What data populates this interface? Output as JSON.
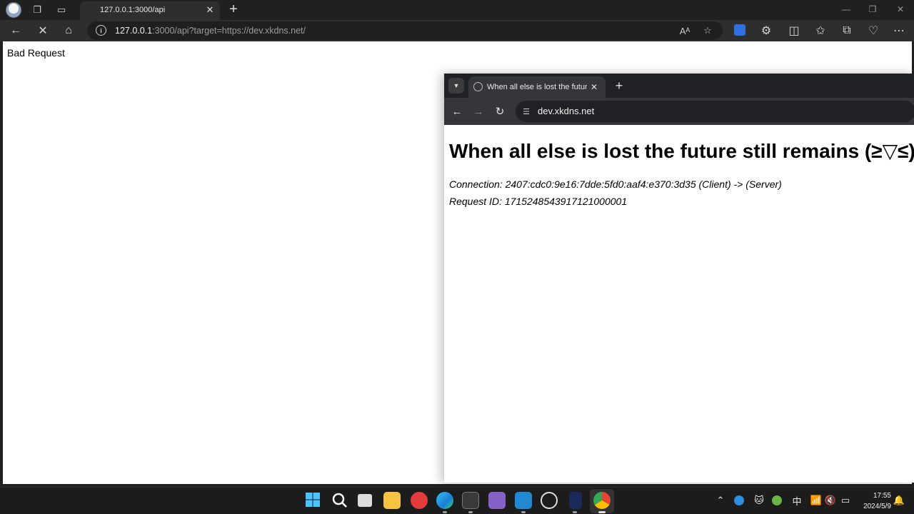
{
  "edge": {
    "tab_title": "127.0.0.1:3000/api",
    "url_host": "127.0.0.1",
    "url_rest": ":3000/api?target=https://dev.xkdns.net/",
    "page_text": "Bad Request",
    "icons": [
      "profile-icon",
      "workspaces-icon",
      "tab-actions-icon",
      "back-icon",
      "stop-loading-icon",
      "home-icon",
      "info-icon",
      "read-aloud-icon",
      "favorite-star-icon",
      "extension-icon",
      "extensions-icon",
      "split-screen-icon",
      "favorites-icon",
      "collections-icon",
      "browser-essentials-icon",
      "more-icon"
    ]
  },
  "chrome": {
    "tab_title": "When all else is lost the future still remains",
    "url": "dev.xkdns.net",
    "heading": "When all else is lost the future still remains (≥▽≤)",
    "connection": "Connection: 2407:cdc0:9e16:7dde:5fd0:aaf4:e370:3d35 (Client) -> (Server)",
    "request_id": "Request ID: 1715248543917121000001"
  },
  "taskbar": {
    "apps": [
      "start",
      "search",
      "task-view",
      "file-explorer",
      "netease-music",
      "edge",
      "terminal",
      "visual-studio",
      "vscode",
      "obs",
      "app-blue",
      "chrome"
    ],
    "time": "17:55",
    "date": "2024/5/9",
    "ime": "中"
  },
  "colors": {
    "edge_frame": "#202020",
    "chrome_frame": "#202124",
    "taskbar": "#1c1c1c"
  }
}
